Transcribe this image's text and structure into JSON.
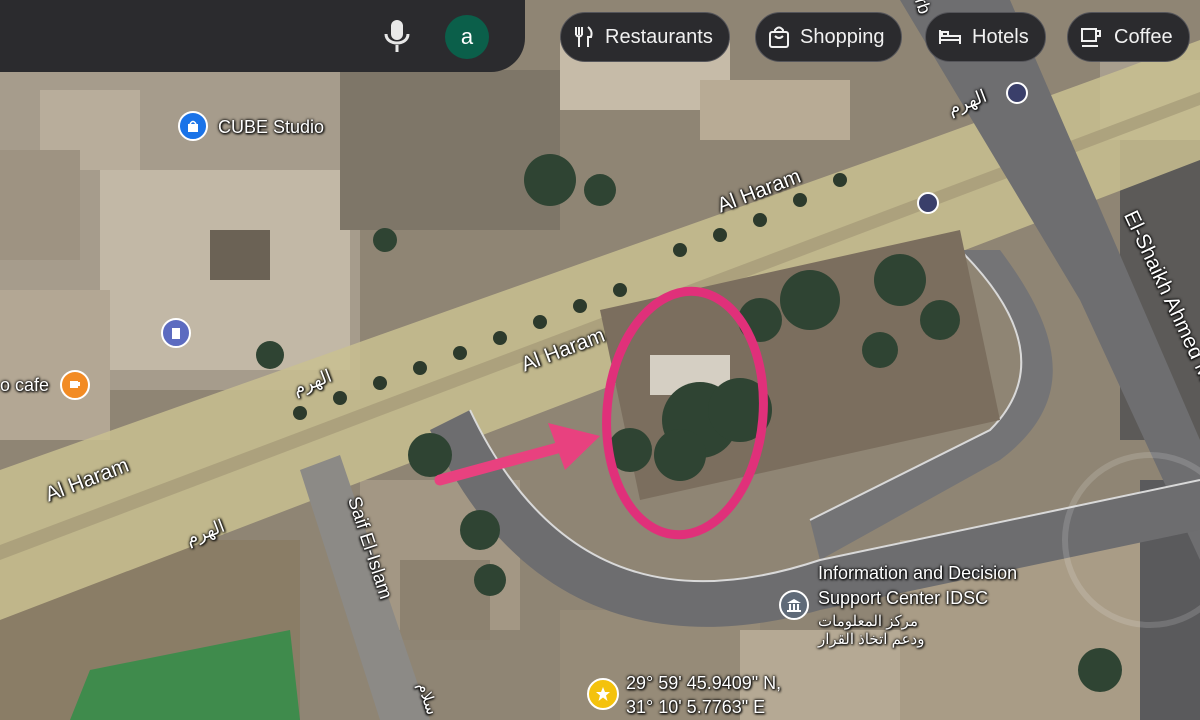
{
  "search": {
    "avatar_letter": "a"
  },
  "chips": [
    {
      "label": "Restaurants",
      "icon": "fork-knife-icon"
    },
    {
      "label": "Shopping",
      "icon": "shopping-bag-icon"
    },
    {
      "label": "Hotels",
      "icon": "bed-icon"
    },
    {
      "label": "Coffee",
      "icon": "coffee-cup-icon"
    }
  ],
  "places": {
    "cube_studio": "CUBE Studio",
    "cafe_partial": "o cafe",
    "idsc_line1": "Information and Decision",
    "idsc_line2": "Support Center IDSC",
    "idsc_arabic_line1": "مركز المعلومات",
    "idsc_arabic_line2": "ودعم اتخاذ القرار"
  },
  "roads": {
    "al_haram": "Al Haram",
    "al_haram_arabic": "الهرم",
    "saif_el_islam": "Saif El-Islam",
    "saif_arabic_partial": "سلام",
    "el_shaikh_ahmed": "El-Shaikh Ahmed M",
    "top_partial": "rb"
  },
  "dropped_pin": {
    "lat": "29° 59' 45.9409\" N,",
    "lng": "31° 10' 5.7763\" E"
  },
  "colors": {
    "highlight_ring": "#e0307a",
    "arrow": "#e8417f",
    "chip_bg": "#2b2b2e",
    "avatar_bg": "#0b5f4a",
    "poi_blue": "#1a73e8",
    "poi_orange": "#f28b24",
    "pin_yellow": "#f4c20d",
    "road_overlay": "#e8d9a0"
  }
}
